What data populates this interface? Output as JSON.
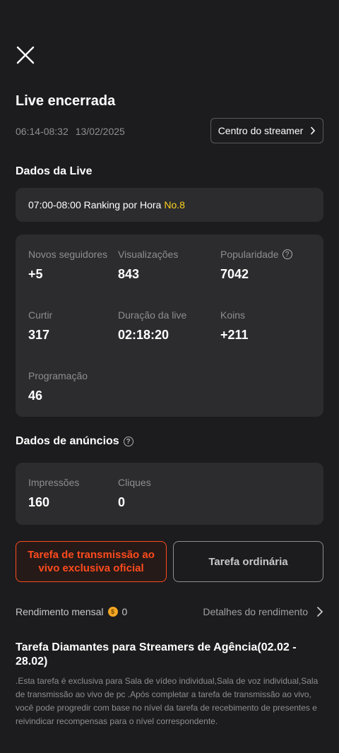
{
  "header": {
    "title": "Live encerrada",
    "time_range": "06:14-08:32",
    "date": "13/02/2025",
    "streamer_center_label": "Centro do streamer"
  },
  "live_data": {
    "section_title": "Dados da Live",
    "ranking_text": "07:00-08:00 Ranking por Hora",
    "ranking_value": "No.8",
    "stats": [
      {
        "label": "Novos seguidores",
        "value": "+5"
      },
      {
        "label": "Visualizações",
        "value": "843"
      },
      {
        "label": "Popularidade",
        "value": "7042"
      },
      {
        "label": "Curtir",
        "value": "317"
      },
      {
        "label": "Duração da live",
        "value": "02:18:20"
      },
      {
        "label": "Koins",
        "value": "+211"
      },
      {
        "label": "Programação",
        "value": "46"
      }
    ]
  },
  "ads_data": {
    "section_title": "Dados de anúncios",
    "stats": [
      {
        "label": "Impressões",
        "value": "160"
      },
      {
        "label": "Cliques",
        "value": "0"
      }
    ]
  },
  "tasks": {
    "official_label": "Tarefa de transmissão ao vivo exclusiva oficial",
    "ordinary_label": "Tarefa ordinária"
  },
  "income": {
    "monthly_label": "Rendimento mensal",
    "monthly_value": "0",
    "details_label": "Detalhes do rendimento"
  },
  "diamond_task": {
    "title": "Tarefa Diamantes para Streamers de Agência(02.02 - 28.02)",
    "description": ".Esta tarefa é exclusiva para Sala de vídeo individual,Sala de voz individual,Sala de transmissão ao vivo de pc .Após completar a tarefa de transmissão ao vivo, você pode progredir com base no nível da tarefa de recebimento de presentes e reivindicar recompensas para o nível correspondente."
  },
  "colors": {
    "background": "#1c1c1e",
    "card": "#2c2c2e",
    "accent_orange": "#ff4a1d",
    "rank_yellow": "#ffd21e"
  }
}
